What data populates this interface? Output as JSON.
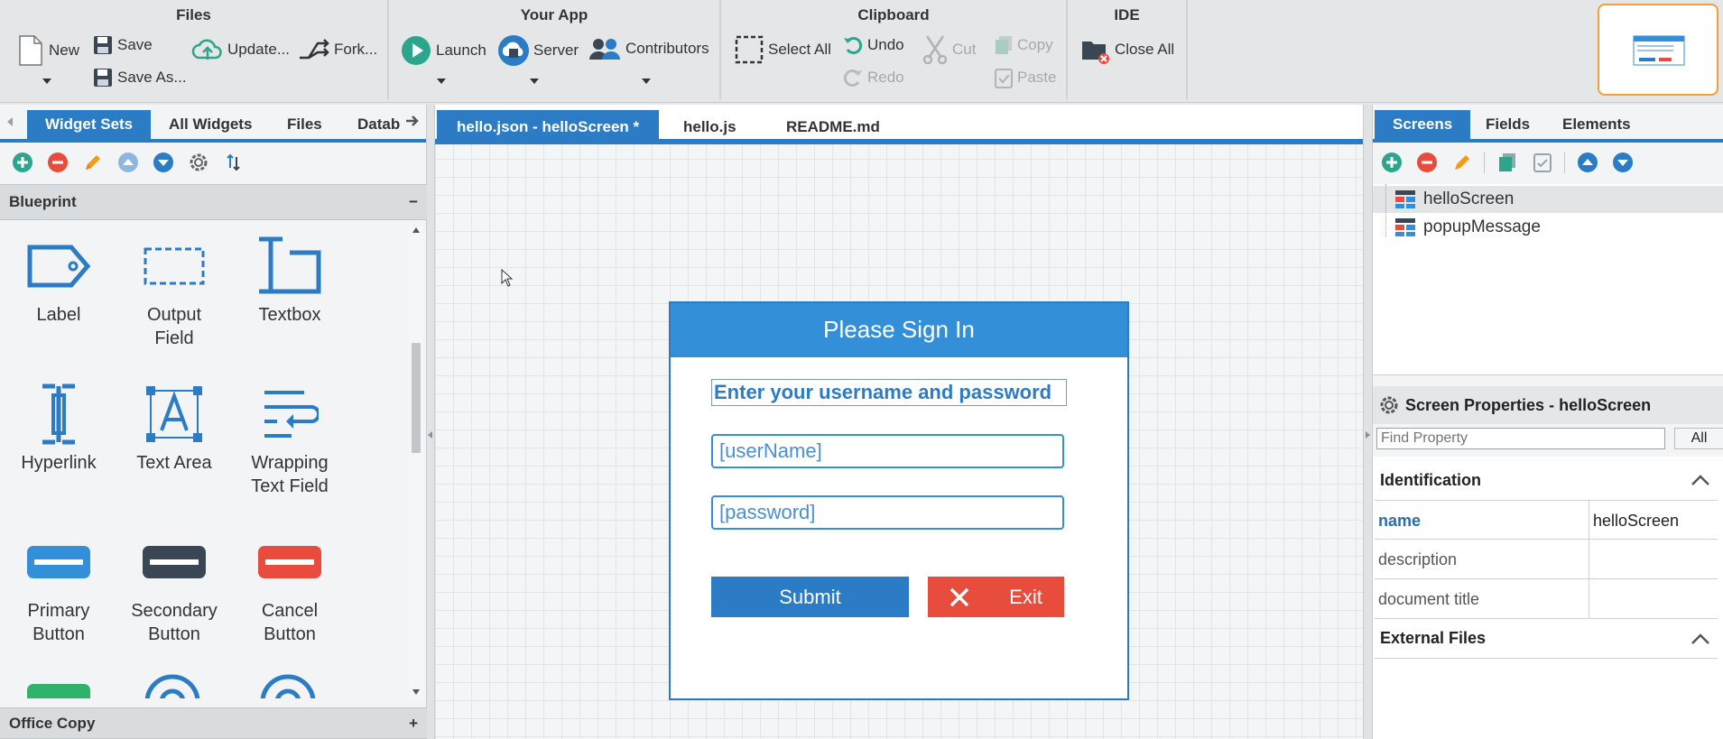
{
  "ribbon": {
    "groups": {
      "files": "Files",
      "your_app": "Your App",
      "clipboard": "Clipboard",
      "ide": "IDE"
    },
    "new": "New",
    "save": "Save",
    "save_as": "Save As...",
    "update": "Update...",
    "fork": "Fork...",
    "launch": "Launch",
    "server": "Server",
    "contributors": "Contributors",
    "select_all": "Select All",
    "undo": "Undo",
    "redo": "Redo",
    "cut": "Cut",
    "copy": "Copy",
    "paste": "Paste",
    "close_all": "Close All"
  },
  "left": {
    "tabs": [
      "Widget Sets",
      "All Widgets",
      "Files",
      "Datab"
    ],
    "blueprint": "Blueprint",
    "blueprint_toggle": "−",
    "widgets": [
      {
        "l1": "Label",
        "l2": ""
      },
      {
        "l1": "Output",
        "l2": "Field"
      },
      {
        "l1": "Textbox",
        "l2": ""
      },
      {
        "l1": "Hyperlink",
        "l2": ""
      },
      {
        "l1": "Text Area",
        "l2": ""
      },
      {
        "l1": "Wrapping",
        "l2": "Text Field"
      },
      {
        "l1": "Primary",
        "l2": "Button"
      },
      {
        "l1": "Secondary",
        "l2": "Button"
      },
      {
        "l1": "Cancel",
        "l2": "Button"
      }
    ],
    "office_copy": "Office Copy",
    "office_toggle": "+"
  },
  "center": {
    "tabs": [
      "hello.json - helloScreen *",
      "hello.js",
      "README.md"
    ],
    "dialog": {
      "title": "Please Sign In",
      "instruction": "Enter your username and password",
      "username": "[userName]",
      "password": "[password]",
      "submit": "Submit",
      "exit": "Exit"
    }
  },
  "right": {
    "tabs": [
      "Screens",
      "Fields",
      "Elements"
    ],
    "screens": [
      "helloScreen",
      "popupMessage"
    ],
    "props_title": "Screen Properties - helloScreen",
    "find_placeholder": "Find Property",
    "all": "All",
    "identification": "Identification",
    "props": [
      {
        "k": "name",
        "v": "helloScreen"
      },
      {
        "k": "description",
        "v": ""
      },
      {
        "k": "document title",
        "v": ""
      }
    ],
    "external_files": "External Files"
  },
  "colors": {
    "accent": "#2b7cc4",
    "dialog_header": "#3390d8",
    "submit": "#2b7cc4",
    "exit": "#e74c3c",
    "thumbnail_border": "#f0a040"
  }
}
